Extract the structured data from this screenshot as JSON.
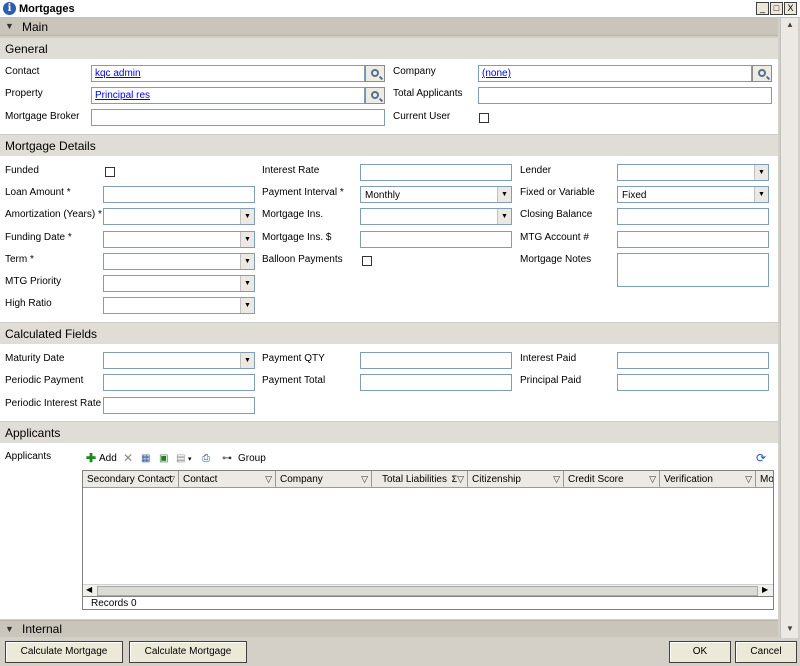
{
  "window": {
    "title": "Mortgages",
    "minimize": "_",
    "restore": "□",
    "close": "X"
  },
  "main_section": {
    "label": "Main"
  },
  "general": {
    "header": "General",
    "contact": {
      "label": "Contact",
      "value": "kqc admin"
    },
    "company": {
      "label": "Company",
      "value": "(none)"
    },
    "property": {
      "label": "Property",
      "value": "Principal res"
    },
    "total_applicants": {
      "label": "Total Applicants",
      "value": ""
    },
    "mortgage_broker": {
      "label": "Mortgage Broker",
      "value": ""
    },
    "current_user": {
      "label": "Current User"
    }
  },
  "mortgage_details": {
    "header": "Mortgage Details",
    "funded": "Funded",
    "loan_amount": "Loan Amount *",
    "amortization": "Amortization (Years) *",
    "funding_date": "Funding Date *",
    "term": "Term *",
    "mtg_priority": "MTG Priority",
    "high_ratio": "High Ratio",
    "interest_rate": "Interest Rate",
    "payment_interval": {
      "label": "Payment Interval *",
      "value": "Monthly"
    },
    "mortgage_ins": "Mortgage Ins.",
    "mortgage_ins_amount": "Mortgage Ins. $",
    "balloon_payments": "Balloon Payments",
    "lender": "Lender",
    "fixed_or_variable": {
      "label": "Fixed or Variable",
      "value": "Fixed"
    },
    "closing_balance": "Closing Balance",
    "mtg_account": "MTG Account #",
    "mortgage_notes": "Mortgage Notes"
  },
  "calculated_fields": {
    "header": "Calculated Fields",
    "maturity_date": "Maturity Date",
    "periodic_payment": "Periodic Payment",
    "periodic_interest_rate": "Periodic Interest Rate",
    "payment_qty": "Payment QTY",
    "payment_total": "Payment Total",
    "interest_paid": "Interest Paid",
    "principal_paid": "Principal Paid"
  },
  "applicants": {
    "header": "Applicants",
    "label": "Applicants",
    "toolbar": {
      "add": "Add",
      "group": "Group"
    },
    "columns": [
      "Secondary Contact",
      "Contact",
      "Company",
      "Total Liabilities",
      "Citizenship",
      "Credit Score",
      "Verification",
      "Mortg"
    ],
    "records": "Records 0"
  },
  "internal_section": {
    "label": "Internal"
  },
  "footer": {
    "calc_can": "Calculate Mortgage (CAN)",
    "calc_usa": "Calculate Mortgage (USA)",
    "ok": "OK",
    "cancel": "Cancel"
  }
}
